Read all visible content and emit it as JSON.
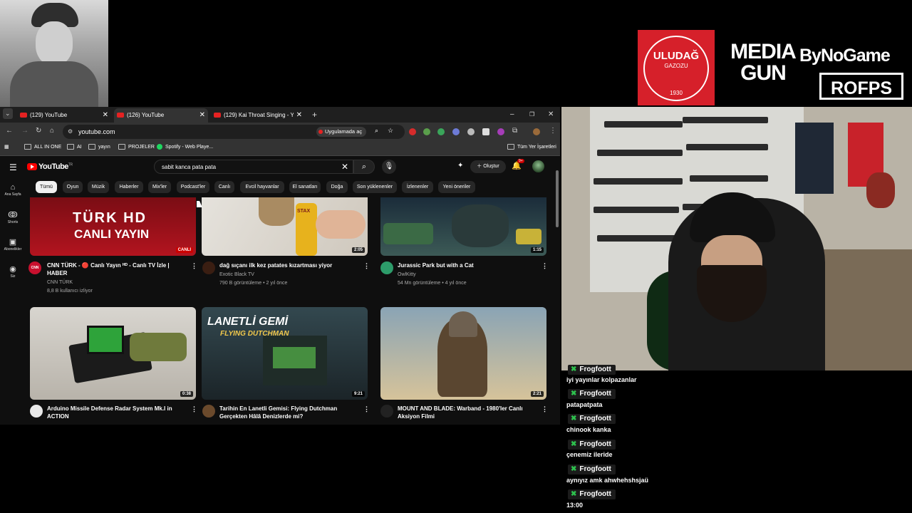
{
  "sponsors": {
    "uludag_brand": "ULUDAĞ",
    "uludag_sub": "GAZOZU",
    "uludag_year": "1930",
    "mediagun_line1": "MEDIA",
    "mediagun_line2": "GUN",
    "bynogame": "ByNoGame",
    "rofps": "ROFPS"
  },
  "browser": {
    "tabs": [
      {
        "title": "(129) YouTube"
      },
      {
        "title": "(126) YouTube"
      },
      {
        "title": "(129) Kai Throat Singing - YouT"
      }
    ],
    "url": "youtube.com",
    "open_in_app": "Uygulamada aç",
    "bookmarks": [
      {
        "label": "ALL IN ONE"
      },
      {
        "label": "AI"
      },
      {
        "label": "yayın"
      },
      {
        "label": "PROJELER"
      },
      {
        "label": "Spotify - Web Playe..."
      },
      {
        "label": "Tüm Yer İşaretleri"
      }
    ]
  },
  "youtube": {
    "logo": "YouTube",
    "logo_country": "TR",
    "search_value": "sabit kanca pata pata",
    "create_label": "Oluştur",
    "notification_count": "9+",
    "guide": [
      {
        "label": "Ana Sayfa",
        "icon": "home-icon"
      },
      {
        "label": "Shorts",
        "icon": "shorts-icon"
      },
      {
        "label": "Abonelikler",
        "icon": "subscriptions-icon"
      },
      {
        "label": "Siz",
        "icon": "you-icon"
      }
    ],
    "chips": [
      {
        "label": "Tümü",
        "selected": true
      },
      {
        "label": "Oyun"
      },
      {
        "label": "Müzik"
      },
      {
        "label": "Haberler"
      },
      {
        "label": "Mix'ler"
      },
      {
        "label": "Podcast'ler"
      },
      {
        "label": "Canlı"
      },
      {
        "label": "Evcil hayvanlar"
      },
      {
        "label": "El sanatları"
      },
      {
        "label": "Doğa"
      },
      {
        "label": "Son yüklenenler"
      },
      {
        "label": "İzlenenler"
      },
      {
        "label": "Yeni öneriler"
      }
    ],
    "videos": [
      {
        "title1": "CNN TÜRK - 🔴 Canlı Yayın ᴴᴰ - Canlı TV İzle |",
        "title2": "HABER",
        "channel": "CNN TÜRK",
        "meta": "8,8 B kullanıcı izliyor",
        "badge": "CANLI",
        "thumb_text1": "TÜRK HD",
        "thumb_text2": "CANLI YAYIN",
        "avatar_text": "CNN",
        "duration": ""
      },
      {
        "title1": "dağ sıçanı ilk kez patates kızartması yiyor",
        "title2": "",
        "channel": "Exotic Black TV",
        "meta": "790 B görüntüleme • 2 yıl önce",
        "duration": "2:05",
        "thumb_text1": "STAX"
      },
      {
        "title1": "Jurassic Park but with a Cat",
        "title2": "",
        "channel": "OwlKitty",
        "meta": "54 Mn görüntüleme • 4 yıl önce",
        "duration": "1:15"
      },
      {
        "title1": "Arduino Missile Defense Radar System Mk.I in",
        "title2": "ACTION",
        "channel": "",
        "meta": "",
        "duration": "0:38"
      },
      {
        "title1": "Tarihin En Lanetli Gemisi: Flying Dutchman",
        "title2": "Gerçekten Hâlâ Denizlerde mi?",
        "channel": "",
        "meta": "",
        "duration": "9:21",
        "thumb_text1": "LANETLİ GEMİ",
        "thumb_text2": "FLYING DUTCHMAN"
      },
      {
        "title1": "MOUNT AND BLADE: Warband - 1980'ler Canlı",
        "title2": "Aksiyon Filmi",
        "channel": "",
        "meta": "",
        "duration": "2:21"
      }
    ]
  },
  "chat": {
    "partial_top": "Frogfoott",
    "first_message": "iyi yayınlar kolpazanlar",
    "messages": [
      {
        "user": "Frogfoott",
        "text": "patapatpata"
      },
      {
        "user": "Frogfoott",
        "text": "chinook kanka"
      },
      {
        "user": "Frogfoott",
        "text": "çenemiz ileride"
      },
      {
        "user": "Frogfoott",
        "text": "aynıyız amk ahwhehshsjaü"
      },
      {
        "user": "Frogfoott",
        "text": "13:00"
      }
    ]
  },
  "colors": {
    "yt_red": "#ff0000",
    "chat_badge": "#2ec24e",
    "uludag_red": "#d6202a"
  }
}
